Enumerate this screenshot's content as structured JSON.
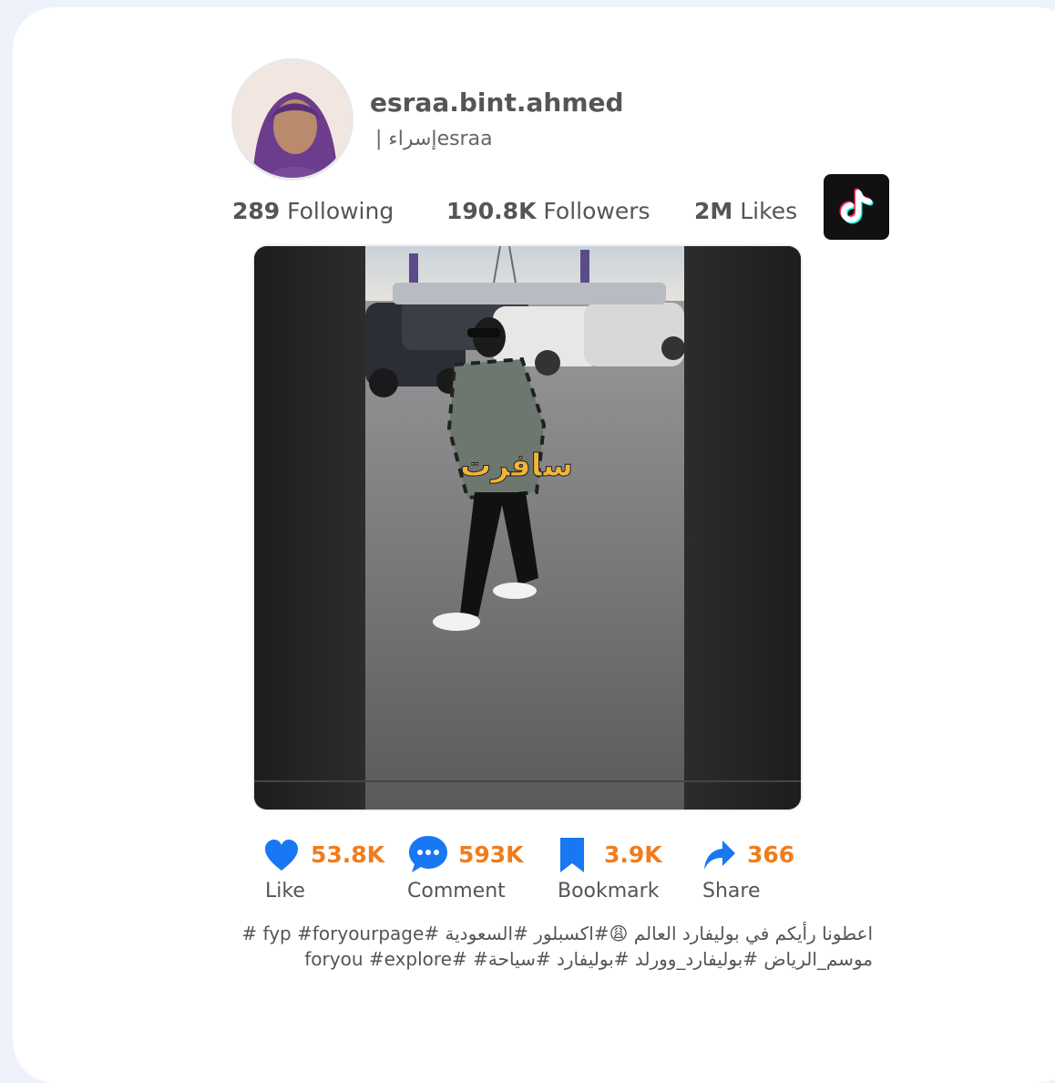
{
  "profile": {
    "username": "esraa.bint.ahmed",
    "nickname": "| إسراءesraa"
  },
  "stats": [
    {
      "value": "289",
      "label": "Following"
    },
    {
      "value": "190.8K",
      "label": "Followers"
    },
    {
      "value": "2M",
      "label": "Likes"
    }
  ],
  "video": {
    "overlay_text": "سافرت"
  },
  "actions": [
    {
      "icon": "heart-icon",
      "count": "53.8K",
      "label": "Like"
    },
    {
      "icon": "comment-icon",
      "count": "593K",
      "label": "Comment"
    },
    {
      "icon": "bookmark-icon",
      "count": "3.9K",
      "label": "Bookmark"
    },
    {
      "icon": "share-icon",
      "count": "366",
      "label": "Share"
    }
  ],
  "caption": {
    "line1": "اعطونا رأيكم في بوليفارد العالم 😩#اكسبلور #السعودية #fyp #foryourpage #",
    "line2": "موسم_الرياض #بوليفارد_وورلد #بوليفارد #سياحة# #foryou #explore"
  },
  "colors": {
    "accent": "#f07c1c",
    "icon_blue": "#1877f2",
    "card": "#ffffff",
    "background": "#eef2fb"
  }
}
